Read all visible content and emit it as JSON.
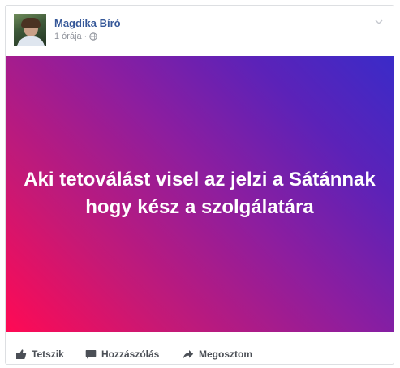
{
  "post": {
    "author_name": "Magdika Bíró",
    "timestamp": "1 órája",
    "separator": "·",
    "audience_icon": "globe-icon",
    "options_icon": "chevron-down-icon",
    "image_text": "Aki tetoválást visel az jelzi a Sátánnak hogy kész a szolgálatára",
    "gradient_colors": [
      "#ff0a54",
      "#8b1ea0",
      "#3a2bc8"
    ]
  },
  "actions": {
    "like_label": "Tetszik",
    "comment_label": "Hozzászólás",
    "share_label": "Megosztom"
  },
  "colors": {
    "name_link": "#365899",
    "meta_text": "#90949c",
    "action_text": "#4b4f56"
  }
}
